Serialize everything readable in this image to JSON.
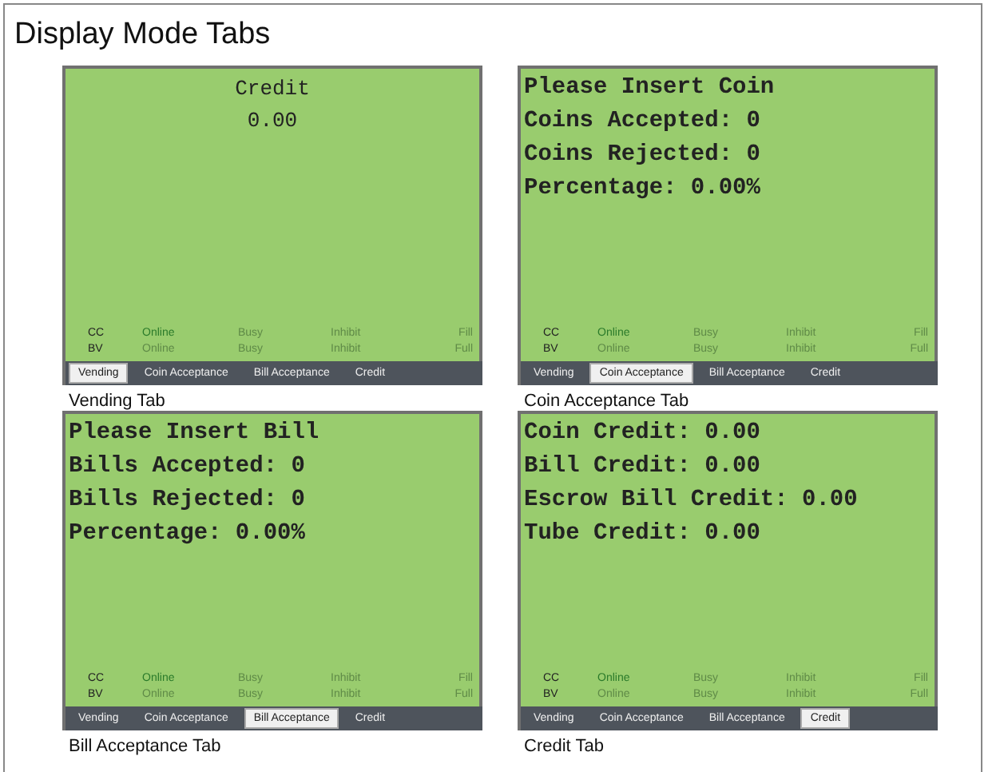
{
  "title": "Display Mode Tabs",
  "panels": [
    {
      "caption": "Vending Tab",
      "screen": {
        "kind": "centered",
        "lines": [
          "Credit",
          "0.00"
        ]
      },
      "status": [
        {
          "label": "CC",
          "items": [
            {
              "text": "Online",
              "on": true
            },
            {
              "text": "Busy",
              "on": false
            },
            {
              "text": "Inhibit",
              "on": false
            },
            {
              "text": "Fill",
              "on": false
            }
          ]
        },
        {
          "label": "BV",
          "items": [
            {
              "text": "Online",
              "on": false
            },
            {
              "text": "Busy",
              "on": false
            },
            {
              "text": "Inhibit",
              "on": false
            },
            {
              "text": "Full",
              "on": false
            }
          ]
        }
      ],
      "tabs": [
        {
          "label": "Vending",
          "selected": true
        },
        {
          "label": "Coin Acceptance",
          "selected": false
        },
        {
          "label": "Bill Acceptance",
          "selected": false
        },
        {
          "label": "Credit",
          "selected": false
        }
      ]
    },
    {
      "caption": "Coin Acceptance Tab",
      "screen": {
        "kind": "list",
        "lines": [
          "Please Insert Coin",
          "Coins Accepted: 0",
          "Coins Rejected: 0",
          "Percentage: 0.00%"
        ]
      },
      "status": [
        {
          "label": "CC",
          "items": [
            {
              "text": "Online",
              "on": true
            },
            {
              "text": "Busy",
              "on": false
            },
            {
              "text": "Inhibit",
              "on": false
            },
            {
              "text": "Fill",
              "on": false
            }
          ]
        },
        {
          "label": "BV",
          "items": [
            {
              "text": "Online",
              "on": false
            },
            {
              "text": "Busy",
              "on": false
            },
            {
              "text": "Inhibit",
              "on": false
            },
            {
              "text": "Full",
              "on": false
            }
          ]
        }
      ],
      "tabs": [
        {
          "label": "Vending",
          "selected": false
        },
        {
          "label": "Coin Acceptance",
          "selected": true
        },
        {
          "label": "Bill Acceptance",
          "selected": false
        },
        {
          "label": "Credit",
          "selected": false
        }
      ]
    },
    {
      "caption": "Bill Acceptance Tab",
      "screen": {
        "kind": "list",
        "lines": [
          "Please Insert Bill",
          "Bills Accepted: 0",
          "Bills Rejected: 0",
          "Percentage: 0.00%"
        ]
      },
      "status": [
        {
          "label": "CC",
          "items": [
            {
              "text": "Online",
              "on": true
            },
            {
              "text": "Busy",
              "on": false
            },
            {
              "text": "Inhibit",
              "on": false
            },
            {
              "text": "Fill",
              "on": false
            }
          ]
        },
        {
          "label": "BV",
          "items": [
            {
              "text": "Online",
              "on": false
            },
            {
              "text": "Busy",
              "on": false
            },
            {
              "text": "Inhibit",
              "on": false
            },
            {
              "text": "Full",
              "on": false
            }
          ]
        }
      ],
      "tabs": [
        {
          "label": "Vending",
          "selected": false
        },
        {
          "label": "Coin Acceptance",
          "selected": false
        },
        {
          "label": "Bill Acceptance",
          "selected": true
        },
        {
          "label": "Credit",
          "selected": false
        }
      ]
    },
    {
      "caption": "Credit Tab",
      "screen": {
        "kind": "list",
        "lines": [
          "Coin Credit: 0.00",
          "Bill Credit: 0.00",
          "Escrow Bill Credit: 0.00",
          "Tube Credit: 0.00"
        ]
      },
      "status": [
        {
          "label": "CC",
          "items": [
            {
              "text": "Online",
              "on": true
            },
            {
              "text": "Busy",
              "on": false
            },
            {
              "text": "Inhibit",
              "on": false
            },
            {
              "text": "Fill",
              "on": false
            }
          ]
        },
        {
          "label": "BV",
          "items": [
            {
              "text": "Online",
              "on": false
            },
            {
              "text": "Busy",
              "on": false
            },
            {
              "text": "Inhibit",
              "on": false
            },
            {
              "text": "Full",
              "on": false
            }
          ]
        }
      ],
      "tabs": [
        {
          "label": "Vending",
          "selected": false
        },
        {
          "label": "Coin Acceptance",
          "selected": false
        },
        {
          "label": "Bill Acceptance",
          "selected": false
        },
        {
          "label": "Credit",
          "selected": true
        }
      ]
    }
  ]
}
